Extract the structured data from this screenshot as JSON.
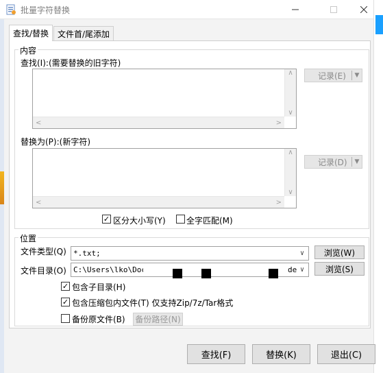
{
  "window": {
    "title": "批量字符替换",
    "minimize_icon": "minimize-icon",
    "maximize_icon": "maximize-icon",
    "close_icon": "close-icon"
  },
  "tabs": [
    {
      "label": "查找/替换",
      "active": true
    },
    {
      "label": "文件首/尾添加",
      "active": false
    }
  ],
  "content_group": {
    "legend": "内容",
    "find_label": "查找(I):(需要替换的旧字符)",
    "find_value": "",
    "find_history_button": "记录(E)",
    "replace_label": "替换为(P):(新字符)",
    "replace_value": "",
    "replace_history_button": "记录(D)",
    "case_sensitive": {
      "label": "区分大小写(Y)",
      "checked": true
    },
    "whole_word": {
      "label": "全字匹配(M)",
      "checked": false
    }
  },
  "location_group": {
    "legend": "位置",
    "file_type_label": "文件类型(Q)",
    "file_type_value": "*.txt;",
    "browse_file_type_button": "浏览(W)",
    "directory_label": "文件目录(O)",
    "directory_value": "C:\\Users\\lko\\Docu",
    "directory_value_tail": "de",
    "browse_directory_button": "浏览(S)",
    "include_subdirs": {
      "label": "包含子目录(H)",
      "checked": true
    },
    "include_archives": {
      "label": "包含压缩包内文件(T) 仅支持Zip/7z/Tar格式",
      "checked": true
    },
    "backup_original": {
      "label": "备份原文件(B)",
      "checked": false
    },
    "backup_path_button": "备份路径(N)"
  },
  "footer": {
    "find_button": "查找(F)",
    "replace_button": "替换(K)",
    "exit_button": "退出(C)"
  }
}
